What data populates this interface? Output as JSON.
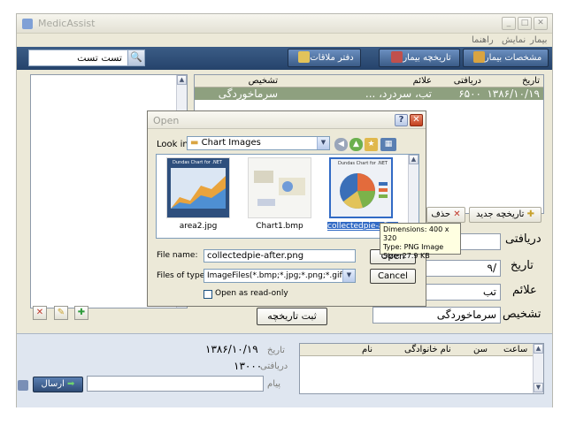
{
  "app": {
    "title": "MedicAssist",
    "menu": [
      "بیمار",
      "نمایش",
      "راهنما"
    ]
  },
  "toolbar": {
    "search_value": "تست تست",
    "btn_specs": "مشخصات بیمار",
    "btn_history": "تاریخچه بیمار",
    "btn_appointments": "دفتر ملاقات"
  },
  "history_grid": {
    "headers": [
      "تاریخ",
      "دریافتی",
      "علائم",
      "تشخیص"
    ],
    "rows": [
      [
        "۱۳۸۶/۱۰/۱۹",
        "۶۵۰۰",
        "تب، سردرد، ...",
        "سرماخوردگی"
      ]
    ]
  },
  "history_actions": {
    "new": "تاریخچه جدید",
    "delete": "حذف"
  },
  "form": {
    "labels": [
      "دریافتی",
      "تاریخ",
      "علائم",
      "تشخیص"
    ],
    "values": [
      "",
      "/۹",
      "تب",
      "سرماخوردگی"
    ],
    "save": "ثبت تاریخچه"
  },
  "bottom": {
    "date_label": "تاریخ",
    "date_value": "۱۳۸۶/۱۰/۱۹",
    "paid_label": "دریافتی",
    "paid_value": "۱۳۰۰۰",
    "message_label": "پیام",
    "send": "ارسال",
    "grid_headers": [
      "ساعت",
      "سن",
      "نام خانوادگی",
      "نام"
    ]
  },
  "dialog": {
    "title": "Open",
    "look_in_label": "Look in:",
    "look_in_value": "Chart Images",
    "files": [
      {
        "name": "area2.jpg",
        "caption": "Dundas Chart for .NET"
      },
      {
        "name": "Chart1.bmp",
        "caption": ""
      },
      {
        "name": "collectedpie-after.png",
        "caption": "Dundas Chart for .NET"
      }
    ],
    "file_name_label": "File name:",
    "file_name_value": "collectedpie-after.png",
    "file_type_label": "Files of type:",
    "file_type_value": "ImageFiles(*.bmp;*.jpg;*.png;*.gif)",
    "open": "Open",
    "cancel": "Cancel",
    "readonly": "Open as read-only",
    "tooltip": [
      "Dimensions: 400 x 320",
      "Type: PNG Image",
      "Size: 27.9 KB"
    ]
  }
}
